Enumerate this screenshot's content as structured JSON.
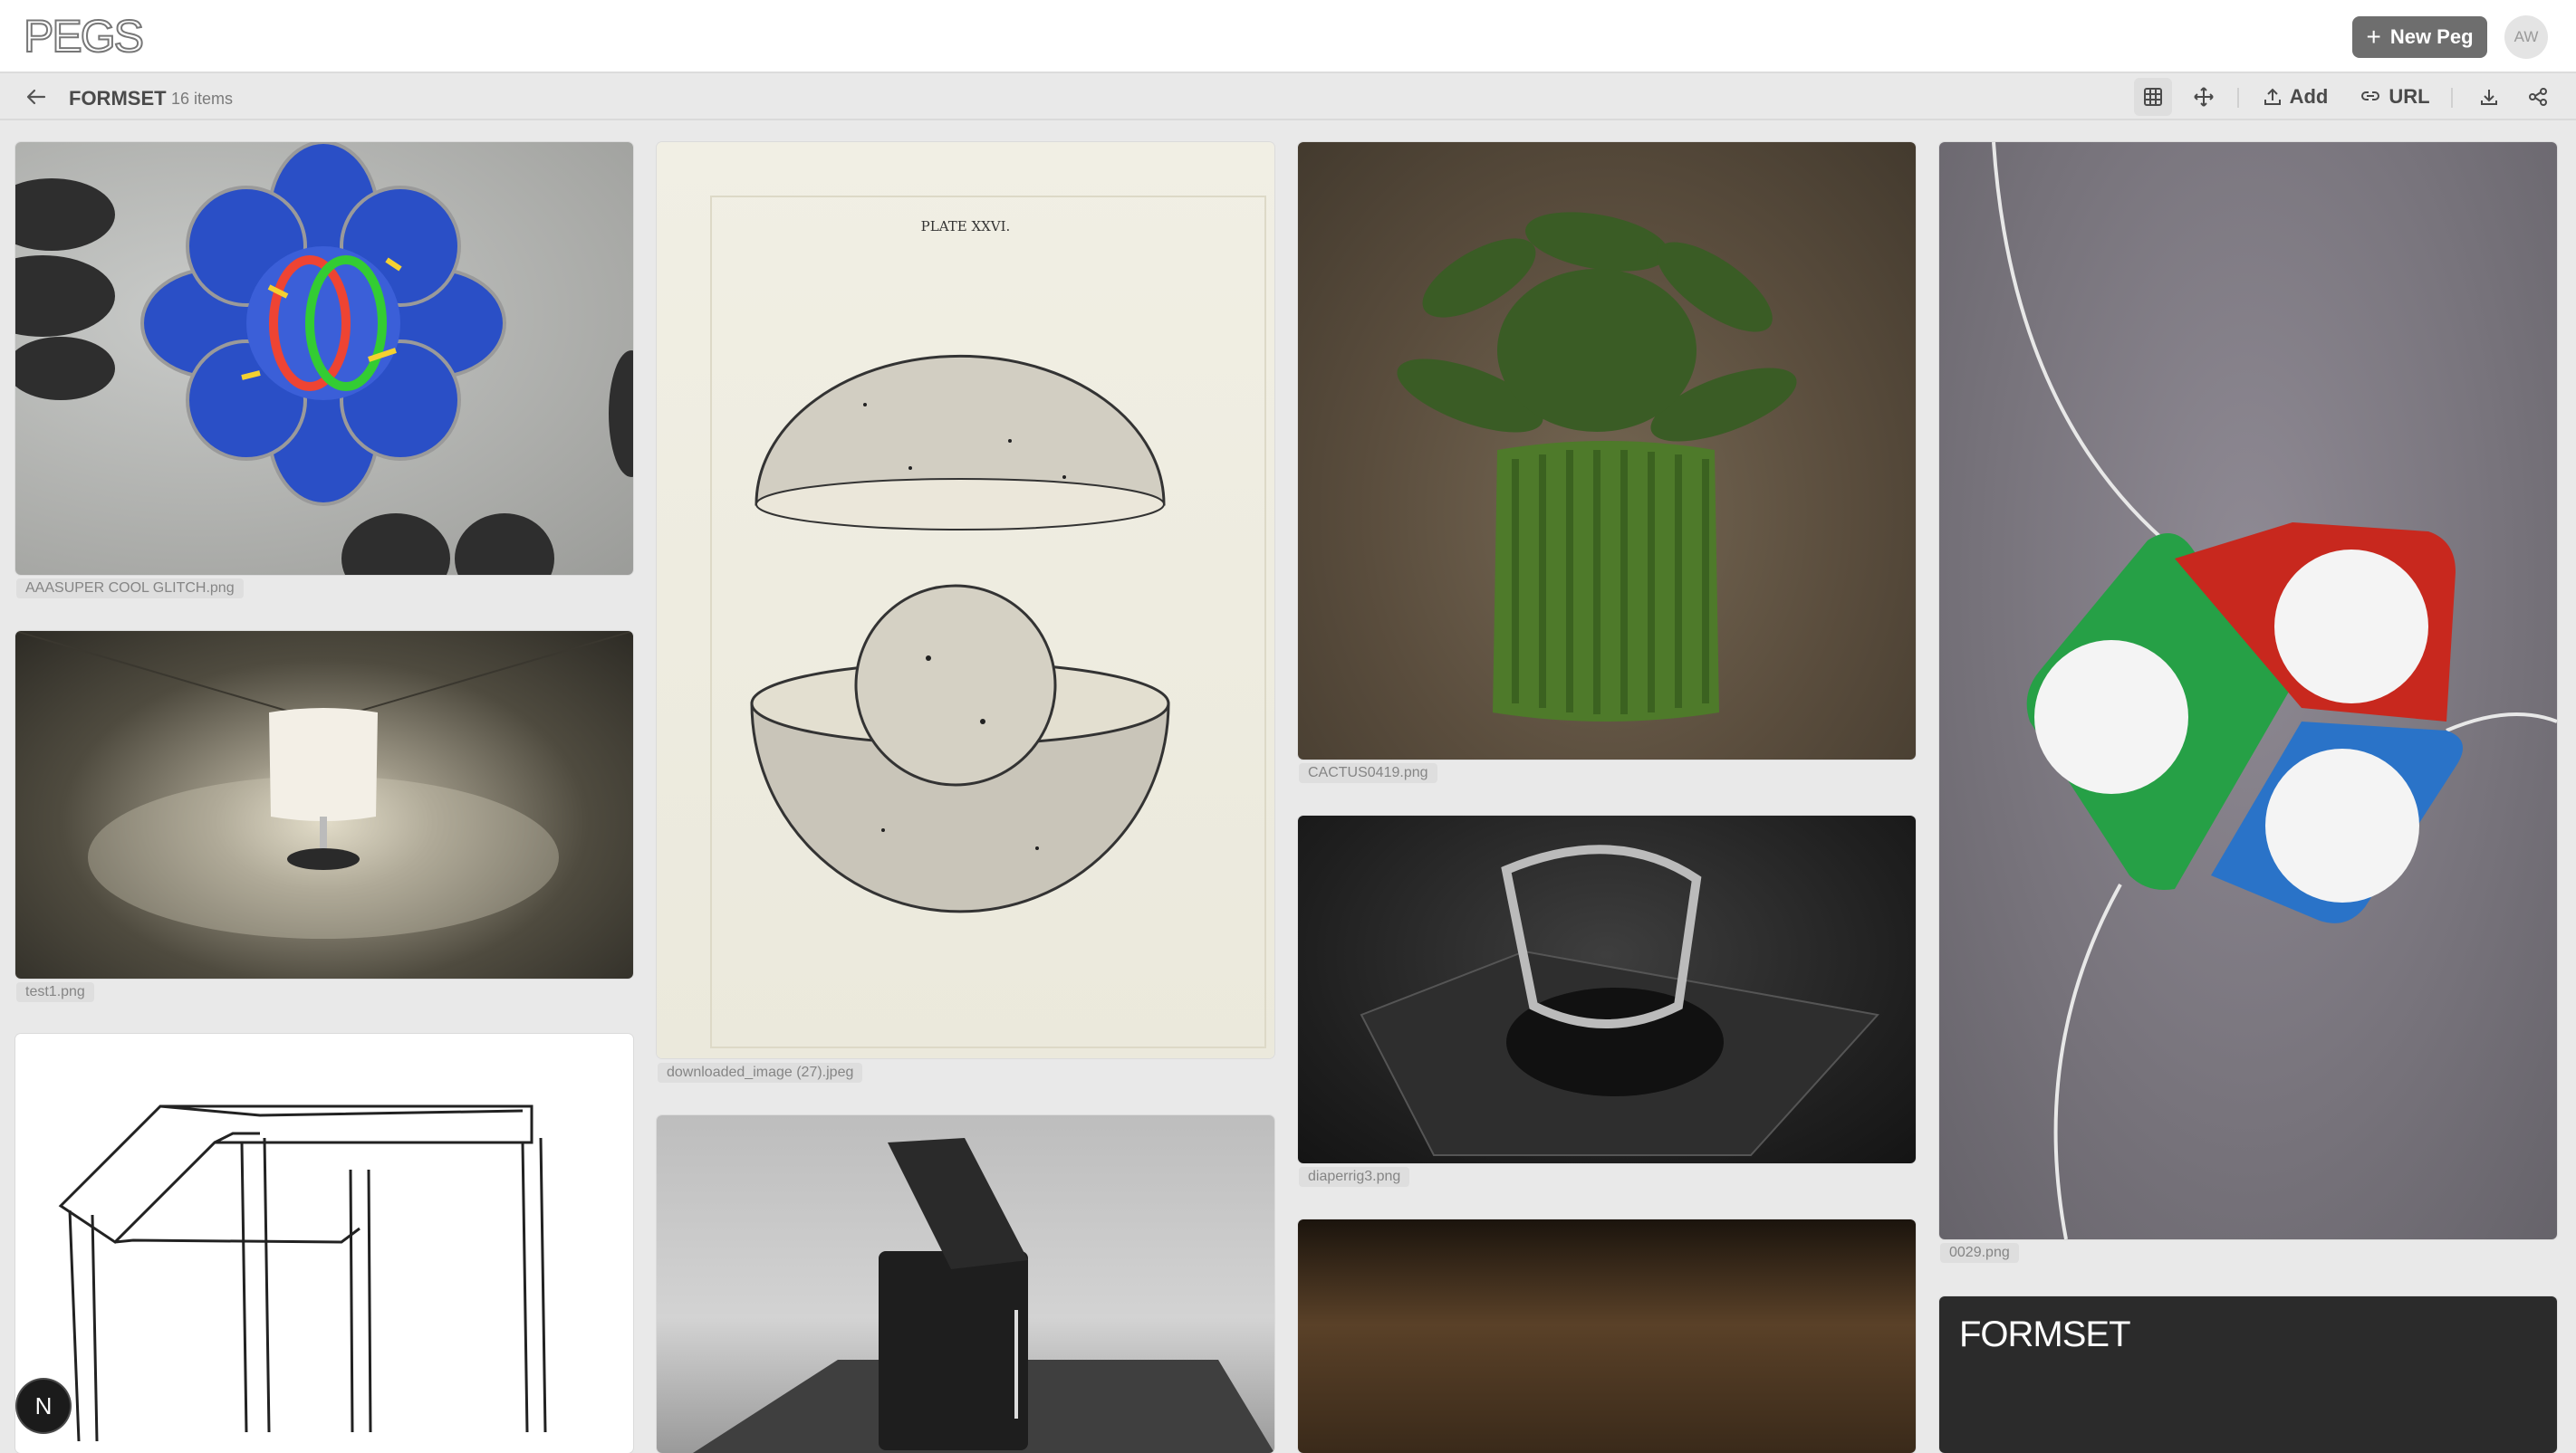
{
  "app": {
    "logo": "PEGS"
  },
  "header": {
    "new_peg_label": "New Peg",
    "avatar_initials": "AW"
  },
  "board": {
    "title": "FORMSET",
    "count": "16 items"
  },
  "toolbar": {
    "add_label": "Add",
    "url_label": "URL"
  },
  "cards": [
    {
      "caption": "AAASUPER COOL GLITCH.png"
    },
    {
      "caption": "test1.png"
    },
    {
      "caption": ""
    },
    {
      "caption": "downloaded_image (27).jpeg",
      "plate_label": "PLATE XXVI."
    },
    {
      "caption": ""
    },
    {
      "caption": "CACTUS0419.png"
    },
    {
      "caption": "diaperrig3.png"
    },
    {
      "caption": ""
    },
    {
      "caption": "0029.png"
    },
    {
      "caption": "",
      "overlay_text": "FORMSET"
    }
  ],
  "badge": {
    "letter": "N"
  },
  "colors": {
    "new_peg_bg": "#6e6e6e",
    "page_bg": "#e9e9e9"
  }
}
